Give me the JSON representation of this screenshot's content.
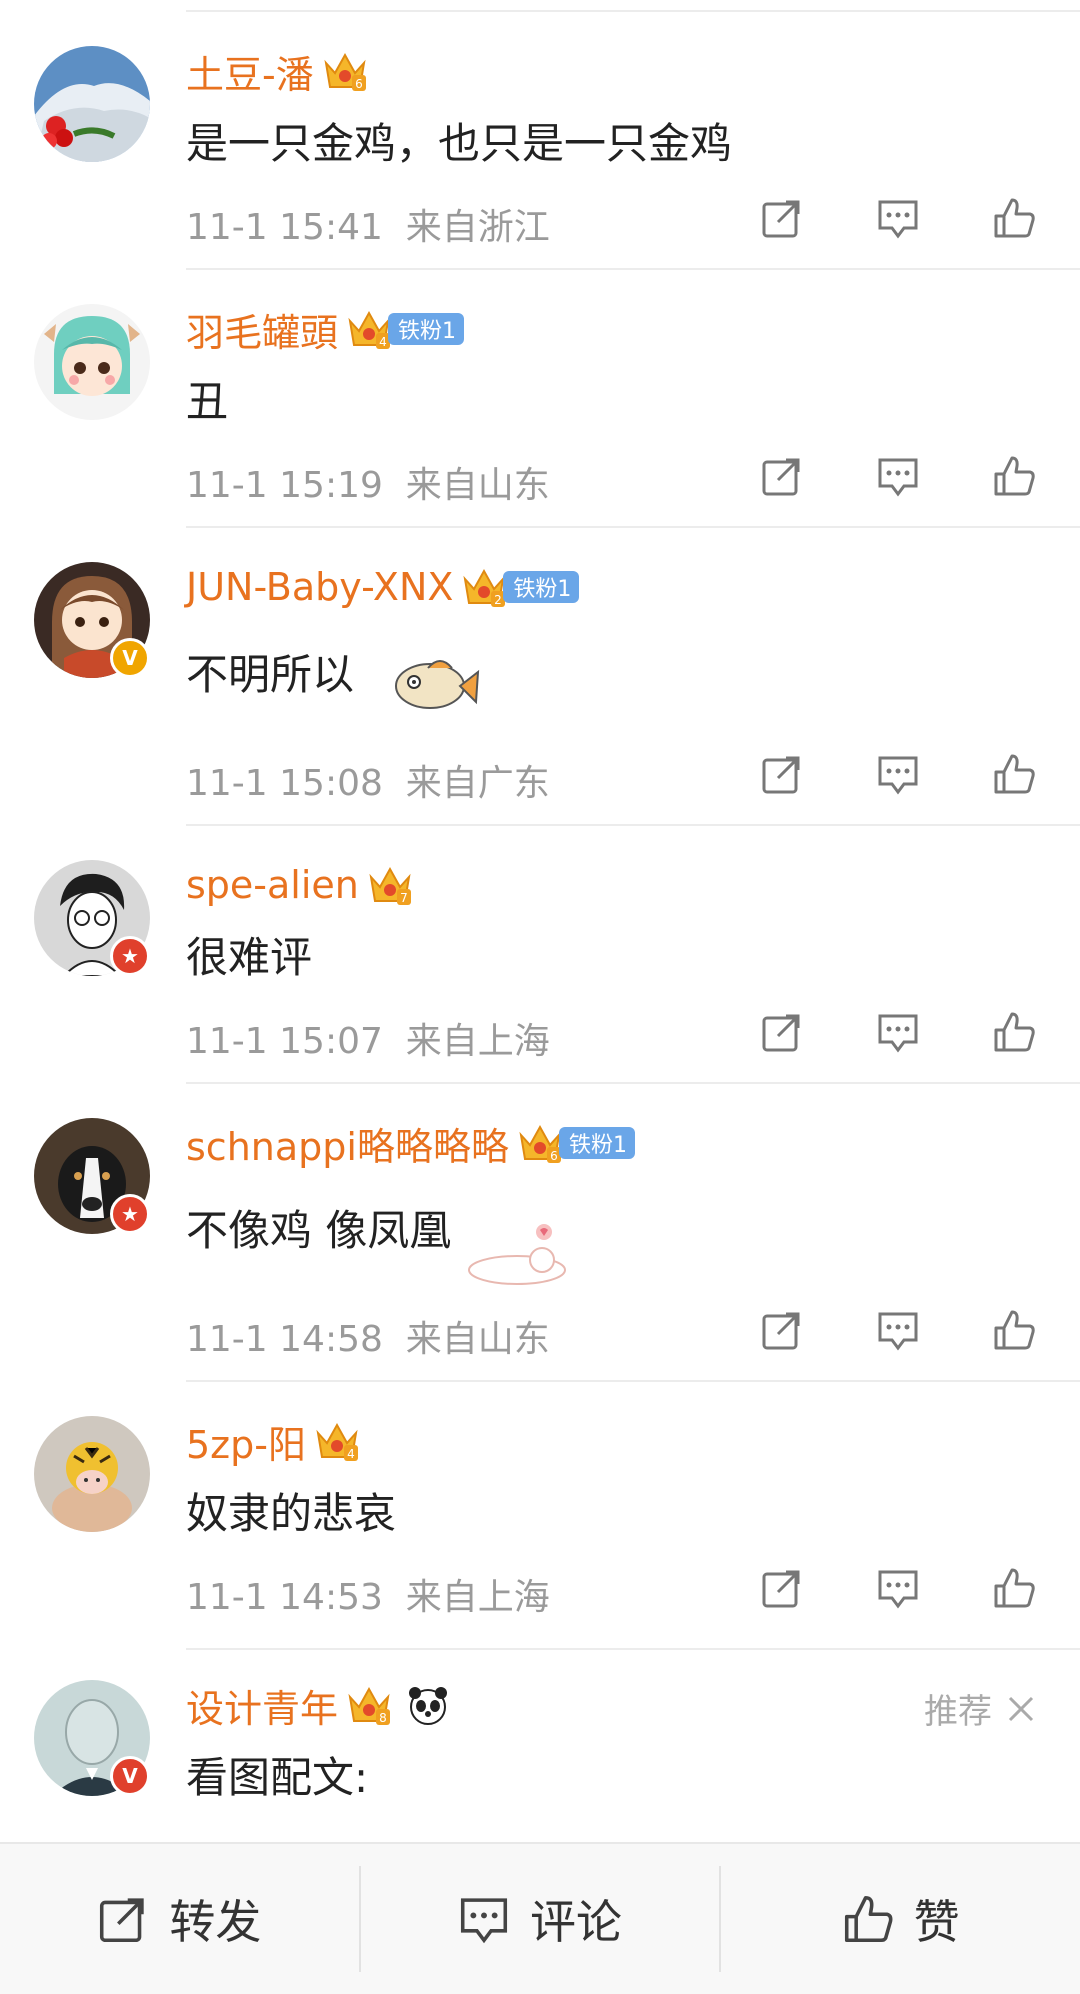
{
  "comments": [
    {
      "name": "土豆-潘",
      "text": "是一只金鸡，也只是一只金鸡",
      "time": "11-1 15:41",
      "location": "来自浙江",
      "crown_level": "6",
      "fan": "",
      "avatar_icon": "mountain-snow-avatar"
    },
    {
      "name": "羽毛罐頭",
      "text": "丑",
      "time": "11-1 15:19",
      "location": "来自山东",
      "crown_level": "4",
      "fan": "铁粉1",
      "avatar_icon": "girl-cartoon-avatar"
    },
    {
      "name": "JUN-Baby-XNX",
      "text": "不明所以",
      "time": "11-1 15:08",
      "location": "来自广东",
      "crown_level": "2",
      "fan": "铁粉1",
      "avatar_icon": "anime-girl-avatar"
    },
    {
      "name": "spe-alien",
      "text": "很难评",
      "time": "11-1 15:07",
      "location": "来自上海",
      "crown_level": "7",
      "fan": "",
      "avatar_icon": "sketch-man-avatar"
    },
    {
      "name": "schnappi略略略略",
      "text": "不像鸡 像凤凰",
      "time": "11-1 14:58",
      "location": "来自山东",
      "crown_level": "6",
      "fan": "铁粉1",
      "avatar_icon": "dog-avatar"
    },
    {
      "name": "5zp-阳",
      "text": "奴隶的悲哀",
      "time": "11-1 14:53",
      "location": "来自上海",
      "crown_level": "4",
      "fan": "",
      "avatar_icon": "tiger-toy-avatar"
    }
  ],
  "last_comment": {
    "name": "设计青年",
    "text": "看图配文:",
    "crown_level": "8",
    "recommend_label": "推荐",
    "avatar_icon": "portrait-avatar"
  },
  "bottom_bar": {
    "repost": "转发",
    "comment": "评论",
    "like": "赞"
  },
  "colors": {
    "name": "#e8721f",
    "meta": "#9a9a9a",
    "fan_badge": "#6aa6e8",
    "verified_orange": "#f0a500",
    "verified_red": "#e0402c"
  }
}
